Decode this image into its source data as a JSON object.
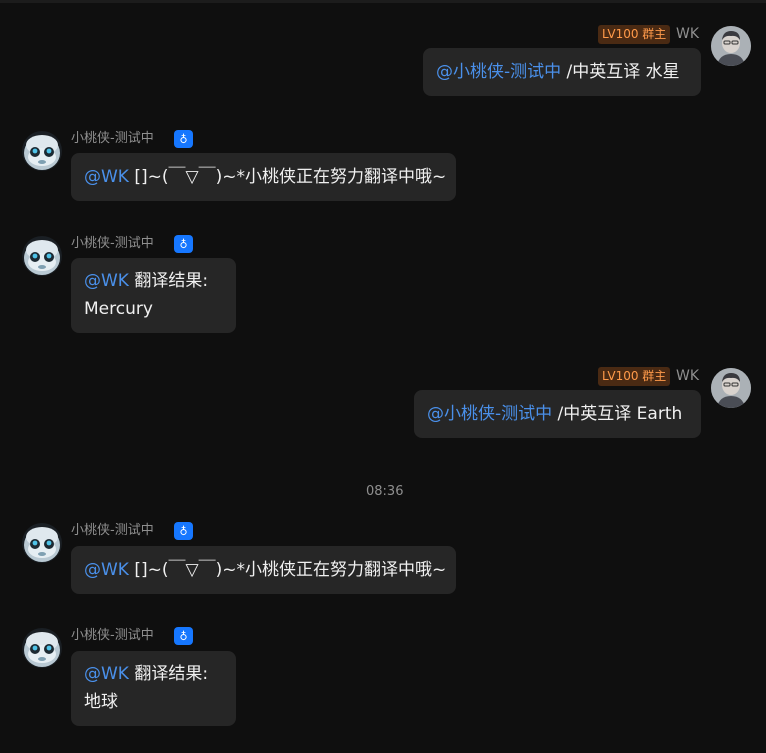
{
  "bot": {
    "name": "小桃侠-测试中",
    "badge_icon": "bot-icon"
  },
  "user": {
    "name": "WK",
    "level_badge": "LV100 群主"
  },
  "messages": [
    {
      "mention": "@小桃侠-测试中",
      "text": " /中英互译 水星"
    },
    {
      "mention": "@WK",
      "text": " []~(￣▽￣)~*小桃侠正在努力翻译中哦~"
    },
    {
      "mention": "@WK",
      "text": " 翻译结果:",
      "line2": "Mercury"
    },
    {
      "mention": "@小桃侠-测试中",
      "text": " /中英互译 Earth"
    },
    {
      "mention": "@WK",
      "text": " []~(￣▽￣)~*小桃侠正在努力翻译中哦~"
    },
    {
      "mention": "@WK",
      "text": " 翻译结果:",
      "line2": "地球"
    }
  ],
  "timestamp": "08:36",
  "colors": {
    "background": "#0f0f0f",
    "bubble": "#262626",
    "mention": "#4a90ea",
    "bot_badge": "#1677ff",
    "level_badge_text": "#ff9a4a"
  }
}
